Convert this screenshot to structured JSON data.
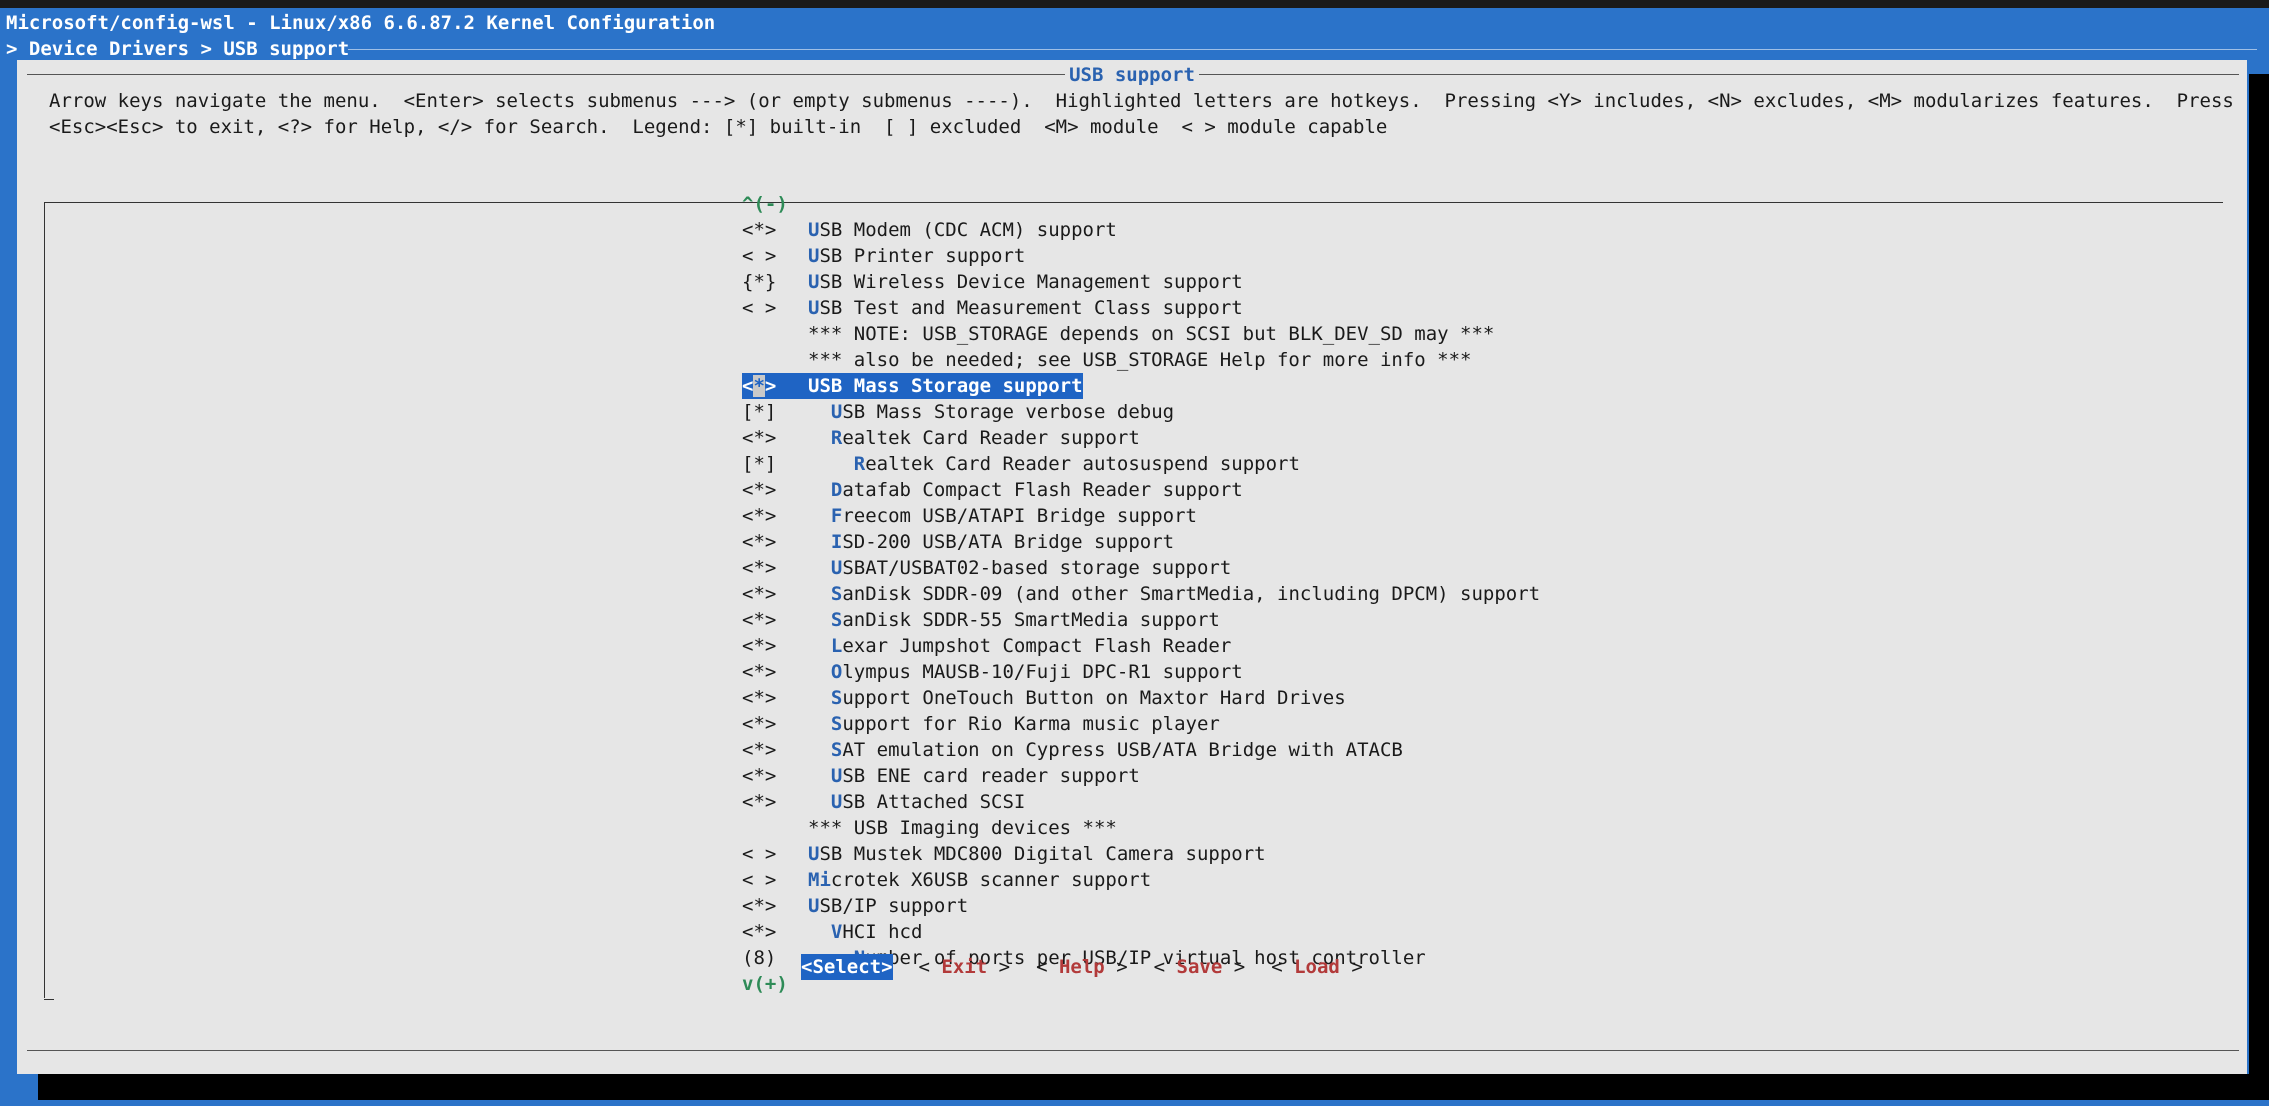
{
  "window": {
    "title": "Microsoft/config-wsl - Linux/x86 6.6.87.2 Kernel Configuration",
    "breadcrumb": "> Device Drivers > USB support"
  },
  "dialog": {
    "title": "USB support",
    "help_line1": "Arrow keys navigate the menu.  <Enter> selects submenus ---> (or empty submenus ----).  Highlighted letters are hotkeys.  Pressing <Y> includes, <N> excludes, <M> modularizes features.  Press",
    "help_line2": "<Esc><Esc> to exit, <?> for Help, </> for Search.  Legend: [*] built-in  [ ] excluded  <M> module  < > module capable",
    "scroll_up": "^(-)",
    "scroll_down": "v(+)"
  },
  "menu": [
    {
      "state": "<*>",
      "indent": "",
      "hk": "U",
      "rest": "SB Modem (CDC ACM) support"
    },
    {
      "state": "< >",
      "indent": "",
      "hk": "U",
      "rest": "SB Printer support"
    },
    {
      "state": "{*}",
      "indent": "",
      "hk": "U",
      "rest": "SB Wireless Device Management support"
    },
    {
      "state": "< >",
      "indent": "",
      "hk": "U",
      "rest": "SB Test and Measurement Class support"
    },
    {
      "state": "",
      "indent": "",
      "hk": "",
      "rest": "*** NOTE: USB_STORAGE depends on SCSI but BLK_DEV_SD may ***"
    },
    {
      "state": "",
      "indent": "",
      "hk": "",
      "rest": "*** also be needed; see USB_STORAGE Help for more info ***"
    },
    {
      "state": "<*>",
      "indent": "",
      "hk": "U",
      "rest": "SB Mass Storage support",
      "selected": true
    },
    {
      "state": "[*]",
      "indent": "  ",
      "hk": "U",
      "rest": "SB Mass Storage verbose debug"
    },
    {
      "state": "<*>",
      "indent": "  ",
      "hk": "R",
      "rest": "ealtek Card Reader support"
    },
    {
      "state": "[*]",
      "indent": "    ",
      "hk": "R",
      "rest": "ealtek Card Reader autosuspend support"
    },
    {
      "state": "<*>",
      "indent": "  ",
      "hk": "D",
      "rest": "atafab Compact Flash Reader support"
    },
    {
      "state": "<*>",
      "indent": "  ",
      "hk": "F",
      "rest": "reecom USB/ATAPI Bridge support"
    },
    {
      "state": "<*>",
      "indent": "  ",
      "hk": "I",
      "rest": "SD-200 USB/ATA Bridge support"
    },
    {
      "state": "<*>",
      "indent": "  ",
      "hk": "U",
      "rest": "SBAT/USBAT02-based storage support"
    },
    {
      "state": "<*>",
      "indent": "  ",
      "hk": "S",
      "rest": "anDisk SDDR-09 (and other SmartMedia, including DPCM) support"
    },
    {
      "state": "<*>",
      "indent": "  ",
      "hk": "S",
      "rest": "anDisk SDDR-55 SmartMedia support"
    },
    {
      "state": "<*>",
      "indent": "  ",
      "hk": "L",
      "rest": "exar Jumpshot Compact Flash Reader"
    },
    {
      "state": "<*>",
      "indent": "  ",
      "hk": "O",
      "rest": "lympus MAUSB-10/Fuji DPC-R1 support"
    },
    {
      "state": "<*>",
      "indent": "  ",
      "hk": "S",
      "rest": "upport OneTouch Button on Maxtor Hard Drives"
    },
    {
      "state": "<*>",
      "indent": "  ",
      "hk": "S",
      "rest": "upport for Rio Karma music player"
    },
    {
      "state": "<*>",
      "indent": "  ",
      "hk": "S",
      "rest": "AT emulation on Cypress USB/ATA Bridge with ATACB"
    },
    {
      "state": "<*>",
      "indent": "  ",
      "hk": "U",
      "rest": "SB ENE card reader support"
    },
    {
      "state": "<*>",
      "indent": "  ",
      "hk": "U",
      "rest": "SB Attached SCSI"
    },
    {
      "state": "",
      "indent": "",
      "hk": "",
      "rest": "*** USB Imaging devices ***"
    },
    {
      "state": "< >",
      "indent": "",
      "hk": "U",
      "rest": "SB Mustek MDC800 Digital Camera support"
    },
    {
      "state": "< >",
      "indent": "",
      "hk": "Mi",
      "pre": "",
      "rest": "crotek X6USB scanner support"
    },
    {
      "state": "<*>",
      "indent": "",
      "hk": "U",
      "rest": "SB/IP support"
    },
    {
      "state": "<*>",
      "indent": "  ",
      "hk": "V",
      "rest": "HCI hcd"
    },
    {
      "state": "(8)",
      "indent": "    ",
      "hk": "N",
      "rest": "umber of ports per USB/IP virtual host controller"
    }
  ],
  "buttons": {
    "select": "<Select>",
    "exit": {
      "open": "< ",
      "key": "E",
      "rest": "xit",
      "close": " >"
    },
    "help": {
      "open": "< ",
      "key": "H",
      "rest": "elp",
      "close": " >"
    },
    "save": {
      "open": "< ",
      "key": "S",
      "rest": "ave",
      "close": " >"
    },
    "load": {
      "open": "< ",
      "key": "L",
      "rest": "oad",
      "close": " >"
    }
  }
}
